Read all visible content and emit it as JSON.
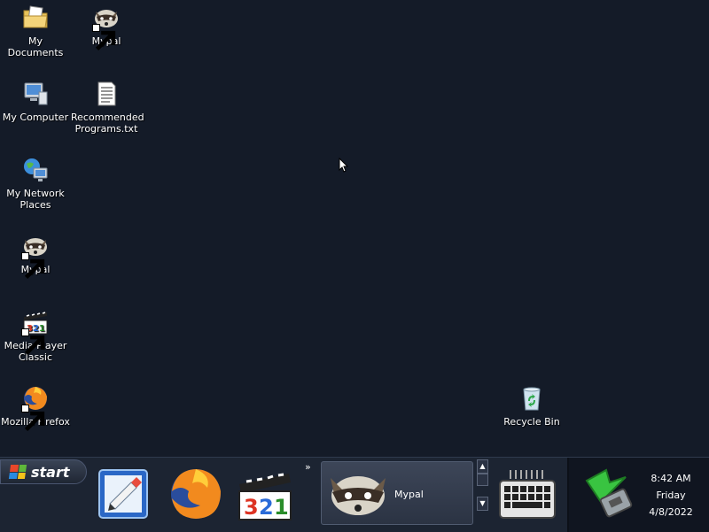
{
  "desktop": {
    "icons": [
      {
        "label": "My Documents",
        "icon": "folder-documents-icon"
      },
      {
        "label": "Mypal",
        "icon": "raccoon-icon",
        "shortcut": true
      },
      {
        "label": "My Computer",
        "icon": "computer-icon"
      },
      {
        "label": "Recommended Programs.txt",
        "icon": "text-file-icon"
      },
      {
        "label": "My Network Places",
        "icon": "network-places-icon"
      },
      {
        "label": "Mypal",
        "icon": "raccoon-icon",
        "shortcut": true
      },
      {
        "label": "Media Player Classic",
        "icon": "mpc-icon",
        "shortcut": true
      },
      {
        "label": "Mozilla Firefox",
        "icon": "firefox-icon",
        "shortcut": true
      },
      {
        "label": "Recycle Bin",
        "icon": "recycle-bin-icon"
      }
    ]
  },
  "taskbar": {
    "start_label": "start",
    "quick_launch": [
      "Show Desktop",
      "Mozilla Firefox",
      "Media Player Classic"
    ],
    "overflow_label": "»",
    "task": {
      "label": "Mypal"
    },
    "clock": {
      "time": "8:42 AM",
      "day": "Friday",
      "date": "4/8/2022"
    }
  },
  "colors": {
    "desktop_bg": "#141b28",
    "taskbar_bg": "#1c2432"
  }
}
